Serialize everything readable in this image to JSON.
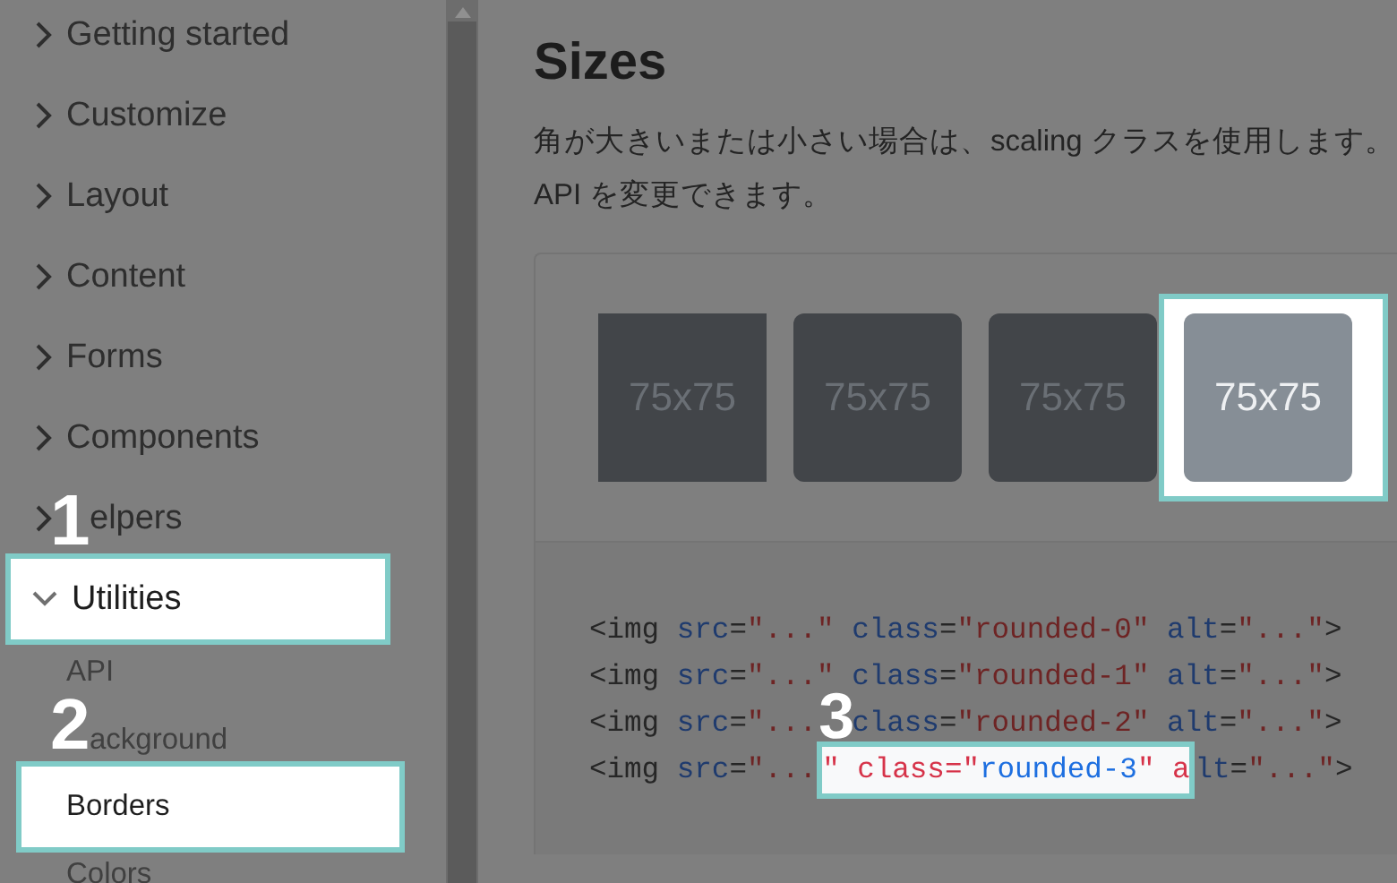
{
  "sidebar": {
    "items": [
      {
        "label": "Getting started",
        "expanded": false,
        "highlighted": false
      },
      {
        "label": "Customize",
        "expanded": false,
        "highlighted": false
      },
      {
        "label": "Layout",
        "expanded": false,
        "highlighted": false
      },
      {
        "label": "Content",
        "expanded": false,
        "highlighted": false
      },
      {
        "label": "Forms",
        "expanded": false,
        "highlighted": false
      },
      {
        "label": "Components",
        "expanded": false,
        "highlighted": false
      },
      {
        "label": "elpers",
        "expanded": false,
        "highlighted": false
      },
      {
        "label": "Utilities",
        "expanded": true,
        "highlighted": true,
        "callout": "1",
        "children": [
          {
            "label": "API",
            "highlighted": false
          },
          {
            "label": "ackground",
            "highlighted": false
          },
          {
            "label": "Borders",
            "highlighted": true,
            "callout": "2"
          },
          {
            "label": "Colors",
            "highlighted": false
          }
        ]
      }
    ]
  },
  "content": {
    "title": "Sizes",
    "description": [
      "角が大きいまたは小さい場合は、scaling クラスを使用します。",
      "API を変更できます。"
    ],
    "tiles": [
      {
        "label": "75x75",
        "kind": "square",
        "highlighted": false
      },
      {
        "label": "75x75",
        "kind": "rounded",
        "highlighted": false
      },
      {
        "label": "75x75",
        "kind": "rounded",
        "highlighted": false
      },
      {
        "label": "75x75",
        "kind": "rounded",
        "highlighted": true
      }
    ],
    "code_lines": [
      [
        {
          "text": "<img",
          "kind": "tag"
        },
        {
          "text": " src",
          "kind": "attr"
        },
        {
          "text": "=",
          "kind": "punct"
        },
        {
          "text": "\"...\"",
          "kind": "string"
        },
        {
          "text": " class",
          "kind": "attr"
        },
        {
          "text": "=",
          "kind": "punct"
        },
        {
          "text": "\"rounded-0\"",
          "kind": "string"
        },
        {
          "text": " alt",
          "kind": "attr"
        },
        {
          "text": "=",
          "kind": "punct"
        },
        {
          "text": "\"...\"",
          "kind": "string"
        },
        {
          "text": ">",
          "kind": "tag"
        }
      ],
      [
        {
          "text": "<img",
          "kind": "tag"
        },
        {
          "text": " src",
          "kind": "attr"
        },
        {
          "text": "=",
          "kind": "punct"
        },
        {
          "text": "\"...\"",
          "kind": "string"
        },
        {
          "text": " class",
          "kind": "attr"
        },
        {
          "text": "=",
          "kind": "punct"
        },
        {
          "text": "\"rounded-1\"",
          "kind": "string"
        },
        {
          "text": " alt",
          "kind": "attr"
        },
        {
          "text": "=",
          "kind": "punct"
        },
        {
          "text": "\"...\"",
          "kind": "string"
        },
        {
          "text": ">",
          "kind": "tag"
        }
      ],
      [
        {
          "text": "<img",
          "kind": "tag"
        },
        {
          "text": " src",
          "kind": "attr"
        },
        {
          "text": "=",
          "kind": "punct"
        },
        {
          "text": "\"...",
          "kind": "string"
        },
        {
          "text": "3",
          "kind": "callout"
        },
        {
          "text": "class",
          "kind": "attr"
        },
        {
          "text": "=",
          "kind": "punct"
        },
        {
          "text": "\"rounded-2\"",
          "kind": "string"
        },
        {
          "text": " alt",
          "kind": "attr"
        },
        {
          "text": "=",
          "kind": "punct"
        },
        {
          "text": "\"...\"",
          "kind": "string"
        },
        {
          "text": ">",
          "kind": "tag"
        }
      ],
      [
        {
          "text": "<img",
          "kind": "tag"
        },
        {
          "text": " src",
          "kind": "attr"
        },
        {
          "text": "=",
          "kind": "punct"
        },
        {
          "text": "\"...",
          "kind": "string"
        },
        {
          "text": "\" class=\"rounded-3\" a",
          "kind": "highlight"
        },
        {
          "text": "lt",
          "kind": "attr"
        },
        {
          "text": "=",
          "kind": "punct"
        },
        {
          "text": "\"...\"",
          "kind": "string"
        },
        {
          "text": ">",
          "kind": "tag"
        }
      ]
    ]
  }
}
